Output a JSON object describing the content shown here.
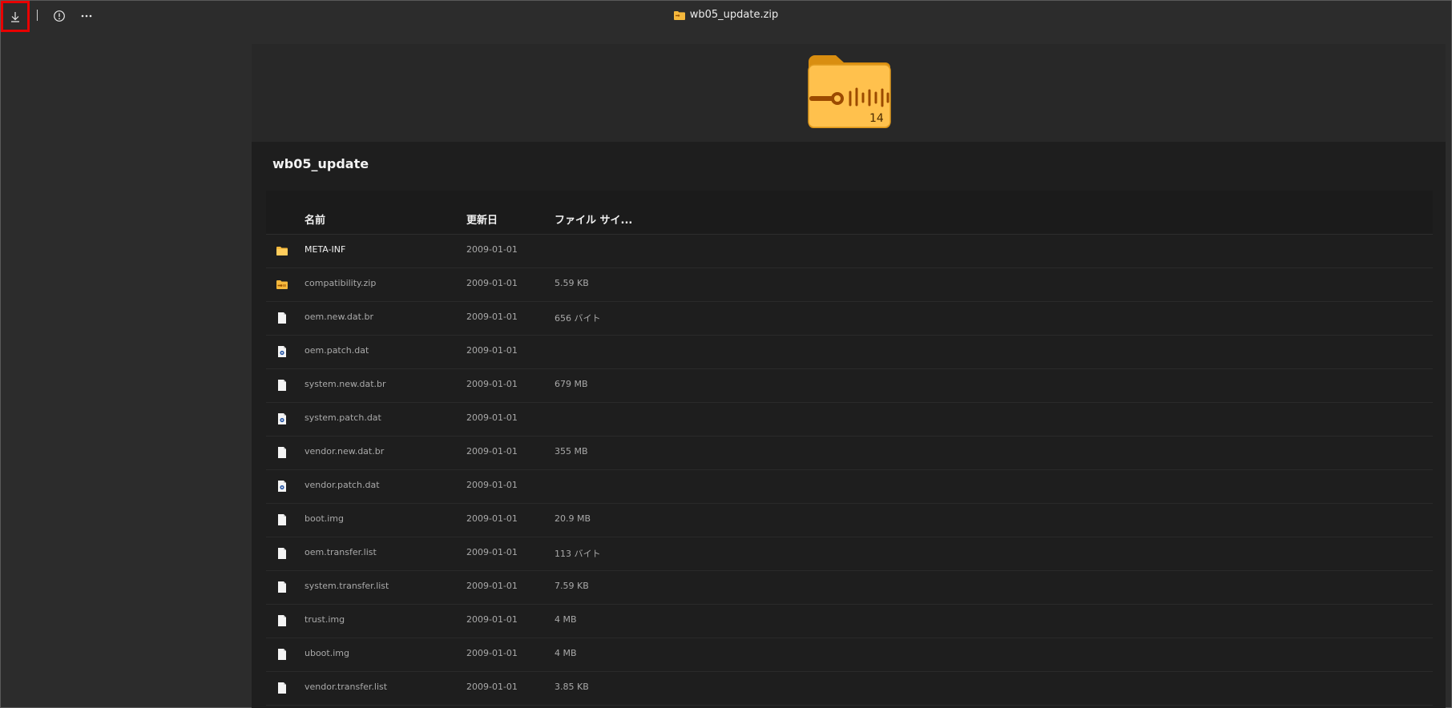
{
  "window": {
    "title": "wb05_update.zip"
  },
  "toolbar": {
    "download_icon": "download-icon",
    "info_icon": "info-icon",
    "more_icon": "more-icon"
  },
  "archive": {
    "name": "wb05_update",
    "item_count": "14"
  },
  "columns": {
    "name": "名前",
    "modified": "更新日",
    "size": "ファイル サイ..."
  },
  "files": [
    {
      "name": "META-INF",
      "date": "2009-01-01",
      "size": "",
      "icon": "folder-icon"
    },
    {
      "name": "compatibility.zip",
      "date": "2009-01-01",
      "size": "5.59 KB",
      "icon": "zip-icon"
    },
    {
      "name": "oem.new.dat.br",
      "date": "2009-01-01",
      "size": "656 バイト",
      "icon": "file-icon"
    },
    {
      "name": "oem.patch.dat",
      "date": "2009-01-01",
      "size": "",
      "icon": "settings-file-icon"
    },
    {
      "name": "system.new.dat.br",
      "date": "2009-01-01",
      "size": "679 MB",
      "icon": "file-icon"
    },
    {
      "name": "system.patch.dat",
      "date": "2009-01-01",
      "size": "",
      "icon": "settings-file-icon"
    },
    {
      "name": "vendor.new.dat.br",
      "date": "2009-01-01",
      "size": "355 MB",
      "icon": "file-icon"
    },
    {
      "name": "vendor.patch.dat",
      "date": "2009-01-01",
      "size": "",
      "icon": "settings-file-icon"
    },
    {
      "name": "boot.img",
      "date": "2009-01-01",
      "size": "20.9 MB",
      "icon": "file-icon"
    },
    {
      "name": "oem.transfer.list",
      "date": "2009-01-01",
      "size": "113 バイト",
      "icon": "file-icon"
    },
    {
      "name": "system.transfer.list",
      "date": "2009-01-01",
      "size": "7.59 KB",
      "icon": "file-icon"
    },
    {
      "name": "trust.img",
      "date": "2009-01-01",
      "size": "4 MB",
      "icon": "file-icon"
    },
    {
      "name": "uboot.img",
      "date": "2009-01-01",
      "size": "4 MB",
      "icon": "file-icon"
    },
    {
      "name": "vendor.transfer.list",
      "date": "2009-01-01",
      "size": "3.85 KB",
      "icon": "file-icon"
    }
  ],
  "colors": {
    "accent_folder": "#f5b83c",
    "highlight": "#e80000",
    "background": "#2c2c2c"
  }
}
